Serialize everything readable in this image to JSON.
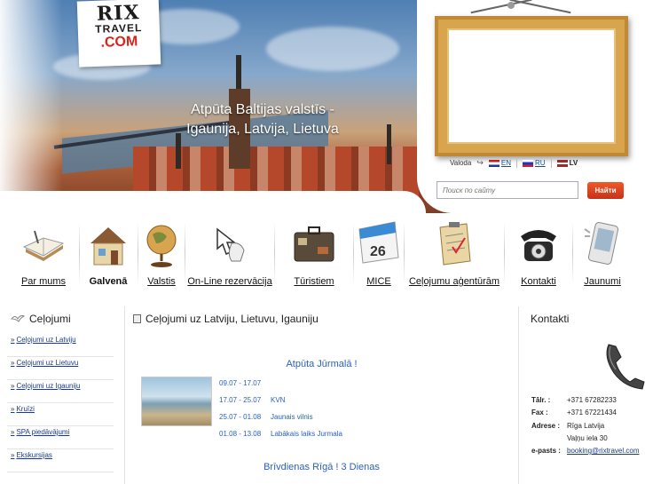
{
  "brand": {
    "line1": "RIX",
    "line2": "TRAVEL",
    "line3": ".COM"
  },
  "header": {
    "headline_line1": "Atpūta Baltijas valstīs -",
    "headline_line2": "Igaunija, Latvija, Lietuva"
  },
  "language": {
    "label": "Valoda",
    "options": [
      {
        "code": "EN",
        "active": false
      },
      {
        "code": "RU",
        "active": false
      },
      {
        "code": "LV",
        "active": true
      }
    ]
  },
  "search": {
    "placeholder": "Поиск по сайту",
    "button": "Найти"
  },
  "nav": [
    {
      "label": "Par mums",
      "icon": "book-icon",
      "active": false
    },
    {
      "label": "Galvenā",
      "icon": "house-icon",
      "active": true
    },
    {
      "label": "Valstis",
      "icon": "globe-icon",
      "active": false
    },
    {
      "label": "On-Line rezervācija",
      "icon": "cursor-hand-icon",
      "active": false
    },
    {
      "label": "Tūristiem",
      "icon": "suitcase-icon",
      "active": false
    },
    {
      "label": "MICE",
      "icon": "calendar-icon",
      "calendar_day": "26",
      "active": false
    },
    {
      "label": "Ceļojumu aģentūrām",
      "icon": "clipboard-icon",
      "active": false
    },
    {
      "label": "Kontakti",
      "icon": "telephone-icon",
      "active": false
    },
    {
      "label": "Jaunumi",
      "icon": "mobile-phone-icon",
      "active": false
    }
  ],
  "sidebar": {
    "title": "Ceļojumi",
    "links": [
      "Ceļojumi uz Latviju",
      "Ceļojumi uz Lietuvu",
      "Ceļojumi uz Igauniju",
      "Kruīzi",
      "SPA piedāvājumi",
      "Ekskursijas"
    ]
  },
  "main": {
    "title": "Ceļojumi uz Latviju, Lietuvu, Igauniju",
    "tour1": {
      "title": "Atpūta  Jūrmalā  !",
      "rows": [
        {
          "dates": "09.07 - 17.07",
          "name": ""
        },
        {
          "dates": "17.07 - 25.07",
          "name": "KVN"
        },
        {
          "dates": "25.07 - 01.08",
          "name": "Jaunais vilnis"
        },
        {
          "dates": "01.08 - 13.08",
          "name": "Labākais laiks Jurmala"
        }
      ]
    },
    "tour2": {
      "title": "Brīvdienas Rīgā !  3 Dienas"
    }
  },
  "contacts": {
    "title": "Kontakti",
    "phone_label": "Tālr. :",
    "phone": "+371 67282233",
    "fax_label": "Fax :",
    "fax": "+371 67221434",
    "address_label": "Adrese :",
    "address1": "Rīga   Latvija",
    "address2": "Vaļņu iela 30",
    "email_label": "e-pasts :",
    "email": "booking@rixtravel.com"
  },
  "colors": {
    "accent": "#d7241c",
    "link": "#1a3a8a",
    "tour_link": "#2a60c4",
    "search_button": "#e04a22"
  }
}
